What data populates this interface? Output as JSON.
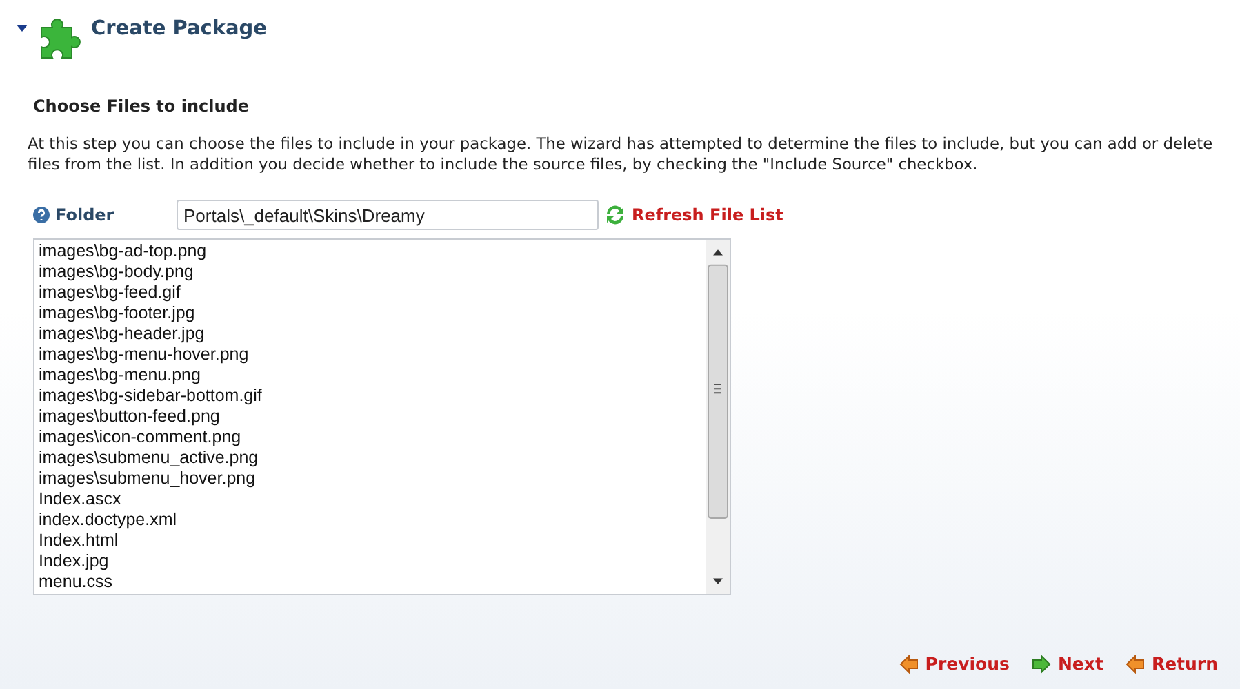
{
  "header": {
    "title": "Create Package"
  },
  "section": {
    "heading": "Choose Files to include",
    "description": "At this step you can choose the files to include in your package. The wizard has attempted to determine the files to include, but you can add or delete files from the list. In addition you decide whether to include the source files, by checking the \"Include Source\" checkbox."
  },
  "folder": {
    "label": "Folder",
    "value": "Portals\\_default\\Skins\\Dreamy",
    "refresh": "Refresh File List"
  },
  "files": [
    "images\\bg-ad-top.png",
    "images\\bg-body.png",
    "images\\bg-feed.gif",
    "images\\bg-footer.jpg",
    "images\\bg-header.jpg",
    "images\\bg-menu-hover.png",
    "images\\bg-menu.png",
    "images\\bg-sidebar-bottom.gif",
    "images\\button-feed.png",
    "images\\icon-comment.png",
    "images\\submenu_active.png",
    "images\\submenu_hover.png",
    "Index.ascx",
    "index.doctype.xml",
    "Index.html",
    "Index.jpg",
    "menu.css"
  ],
  "nav": [
    {
      "label": "Previous",
      "kind": "back"
    },
    {
      "label": "Next",
      "kind": "forward"
    },
    {
      "label": "Return",
      "kind": "back"
    }
  ]
}
